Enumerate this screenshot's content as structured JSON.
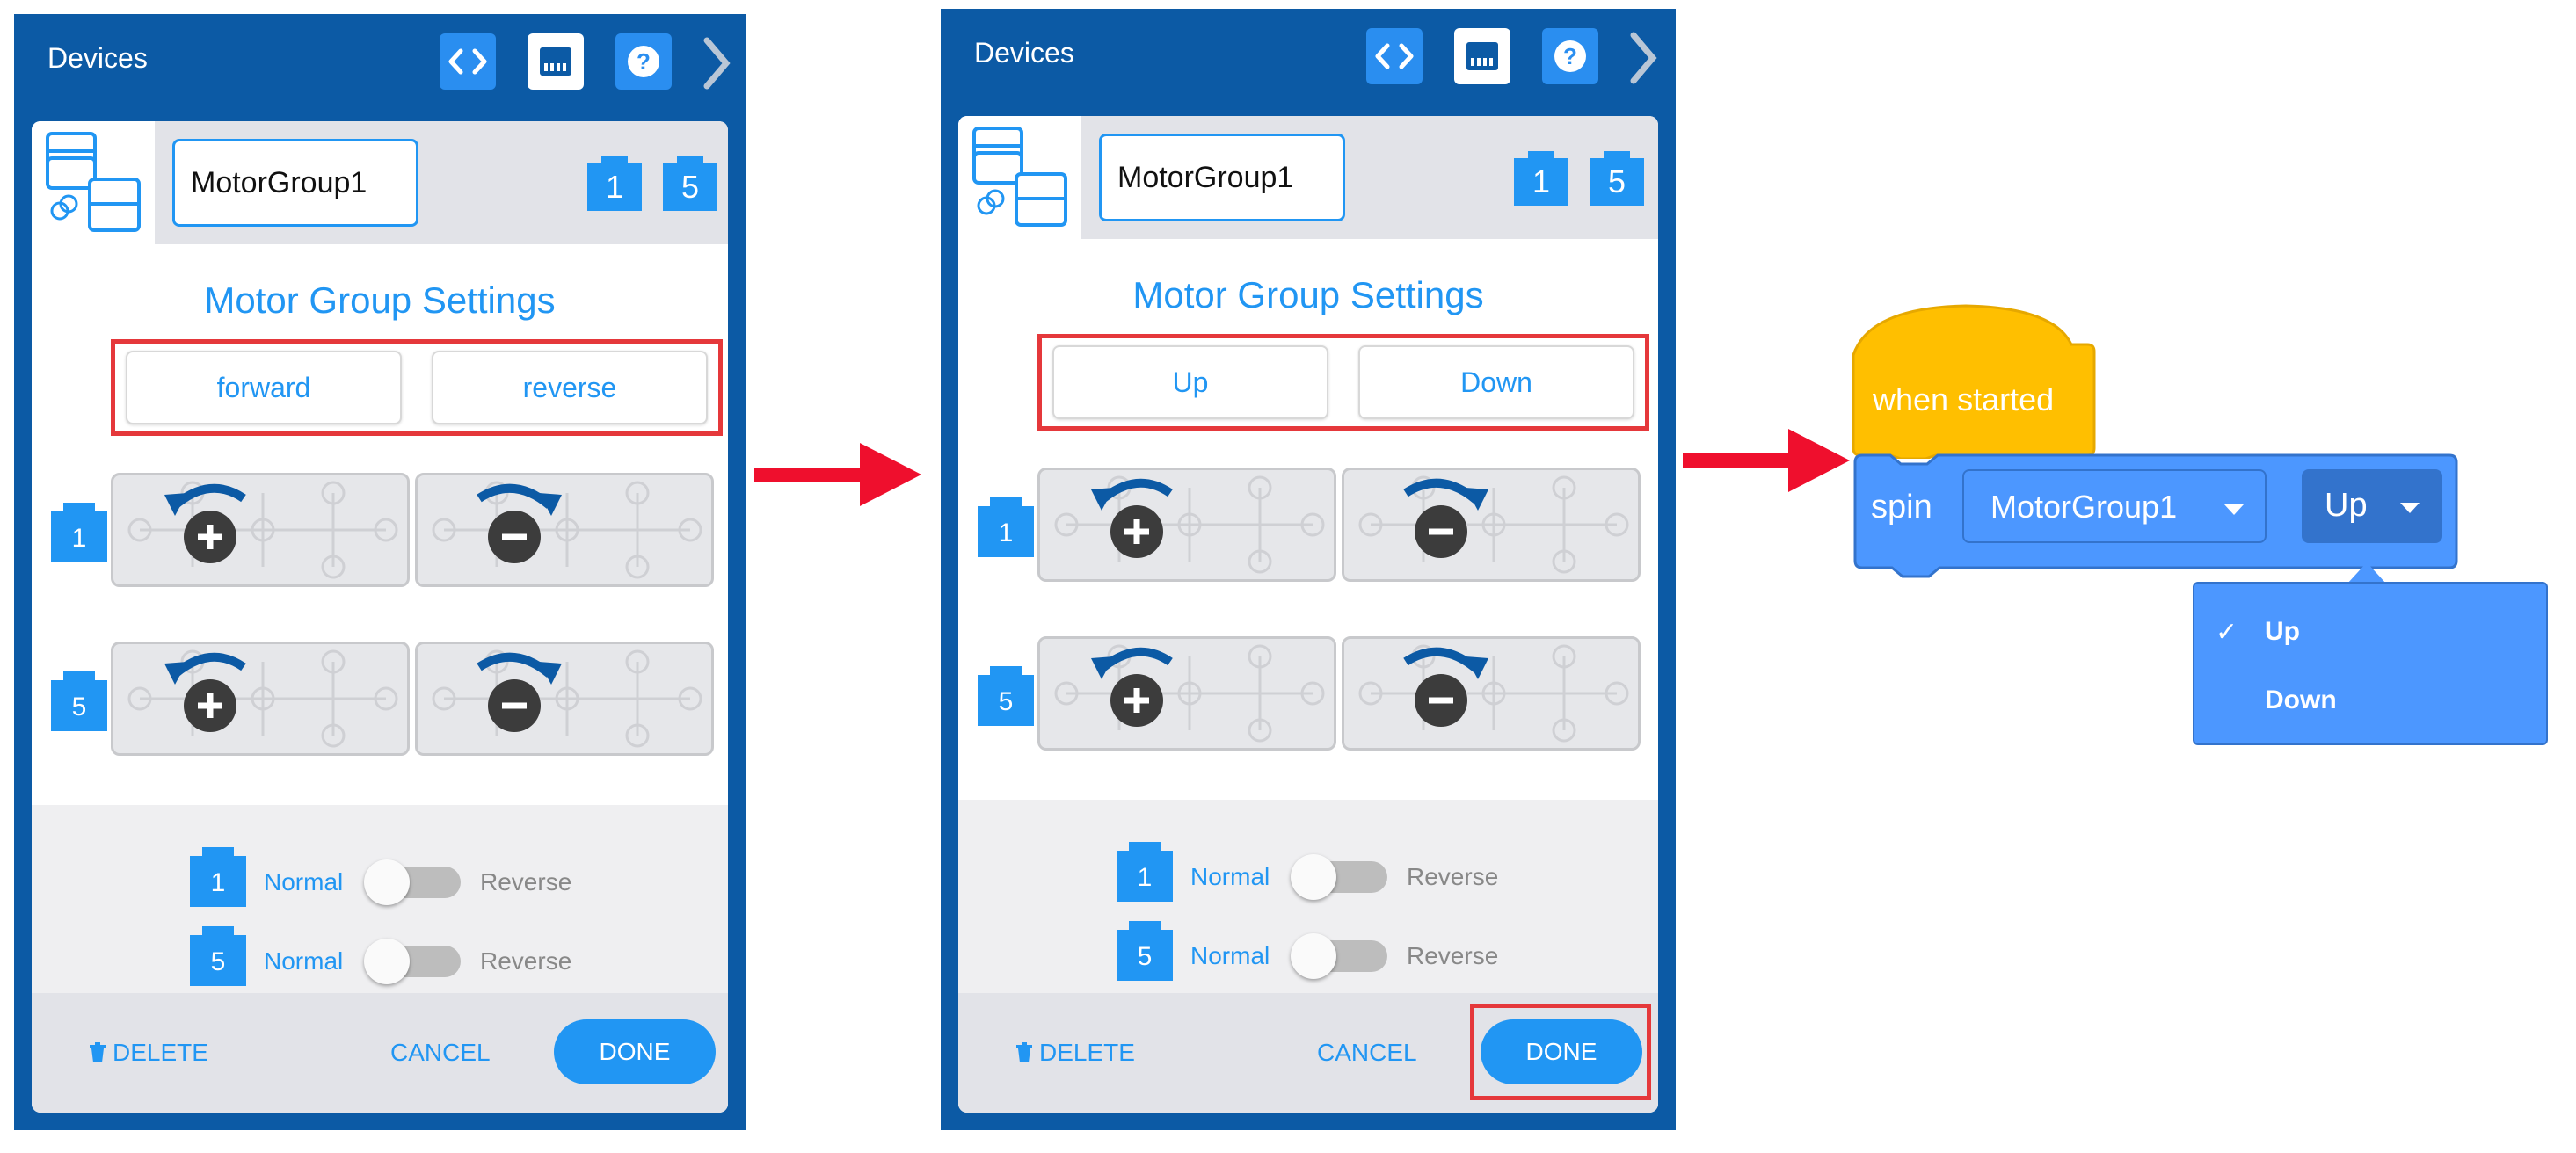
{
  "colors": {
    "panel_frame": "#0c5aa5",
    "accent_blue": "#2196f3",
    "highlight_red": "#e5383b",
    "arrow_red": "#ef0f2d",
    "hat_block": "#ffbf00",
    "motion_block": "#4c97ff",
    "motion_block_dark": "#3373cc"
  },
  "panels": [
    {
      "topbar": {
        "title": "Devices",
        "icons": [
          "code-icon",
          "brain-device-icon",
          "help-icon",
          "chevron-right-icon"
        ]
      },
      "header": {
        "device_name": "MotorGroup1",
        "ports": [
          "1",
          "5"
        ]
      },
      "settings_title": "Motor Group Settings",
      "directions": {
        "forward": "forward",
        "reverse": "reverse"
      },
      "motors": [
        {
          "port": "1",
          "plus_icon": "plus-icon",
          "minus_icon": "minus-icon"
        },
        {
          "port": "5",
          "plus_icon": "plus-icon",
          "minus_icon": "minus-icon"
        }
      ],
      "reverse_rows": [
        {
          "port": "1",
          "normal": "Normal",
          "reverse": "Reverse",
          "reversed": false
        },
        {
          "port": "5",
          "normal": "Normal",
          "reverse": "Reverse",
          "reversed": false
        }
      ],
      "footer": {
        "delete": "DELETE",
        "cancel": "CANCEL",
        "done": "DONE"
      }
    },
    {
      "topbar": {
        "title": "Devices",
        "icons": [
          "code-icon",
          "brain-device-icon",
          "help-icon",
          "chevron-right-icon"
        ]
      },
      "header": {
        "device_name": "MotorGroup1",
        "ports": [
          "1",
          "5"
        ]
      },
      "settings_title": "Motor Group Settings",
      "directions": {
        "forward": "Up",
        "reverse": "Down"
      },
      "motors": [
        {
          "port": "1",
          "plus_icon": "plus-icon",
          "minus_icon": "minus-icon"
        },
        {
          "port": "5",
          "plus_icon": "plus-icon",
          "minus_icon": "minus-icon"
        }
      ],
      "reverse_rows": [
        {
          "port": "1",
          "normal": "Normal",
          "reverse": "Reverse",
          "reversed": false
        },
        {
          "port": "5",
          "normal": "Normal",
          "reverse": "Reverse",
          "reversed": false
        }
      ],
      "footer": {
        "delete": "DELETE",
        "cancel": "CANCEL",
        "done": "DONE"
      }
    }
  ],
  "blocks": {
    "hat": "when started",
    "spin": {
      "label": "spin",
      "device": "MotorGroup1",
      "direction": "Up"
    },
    "dropdown": {
      "options": [
        "Up",
        "Down"
      ],
      "selected": "Up",
      "check_mark": "✓"
    }
  }
}
